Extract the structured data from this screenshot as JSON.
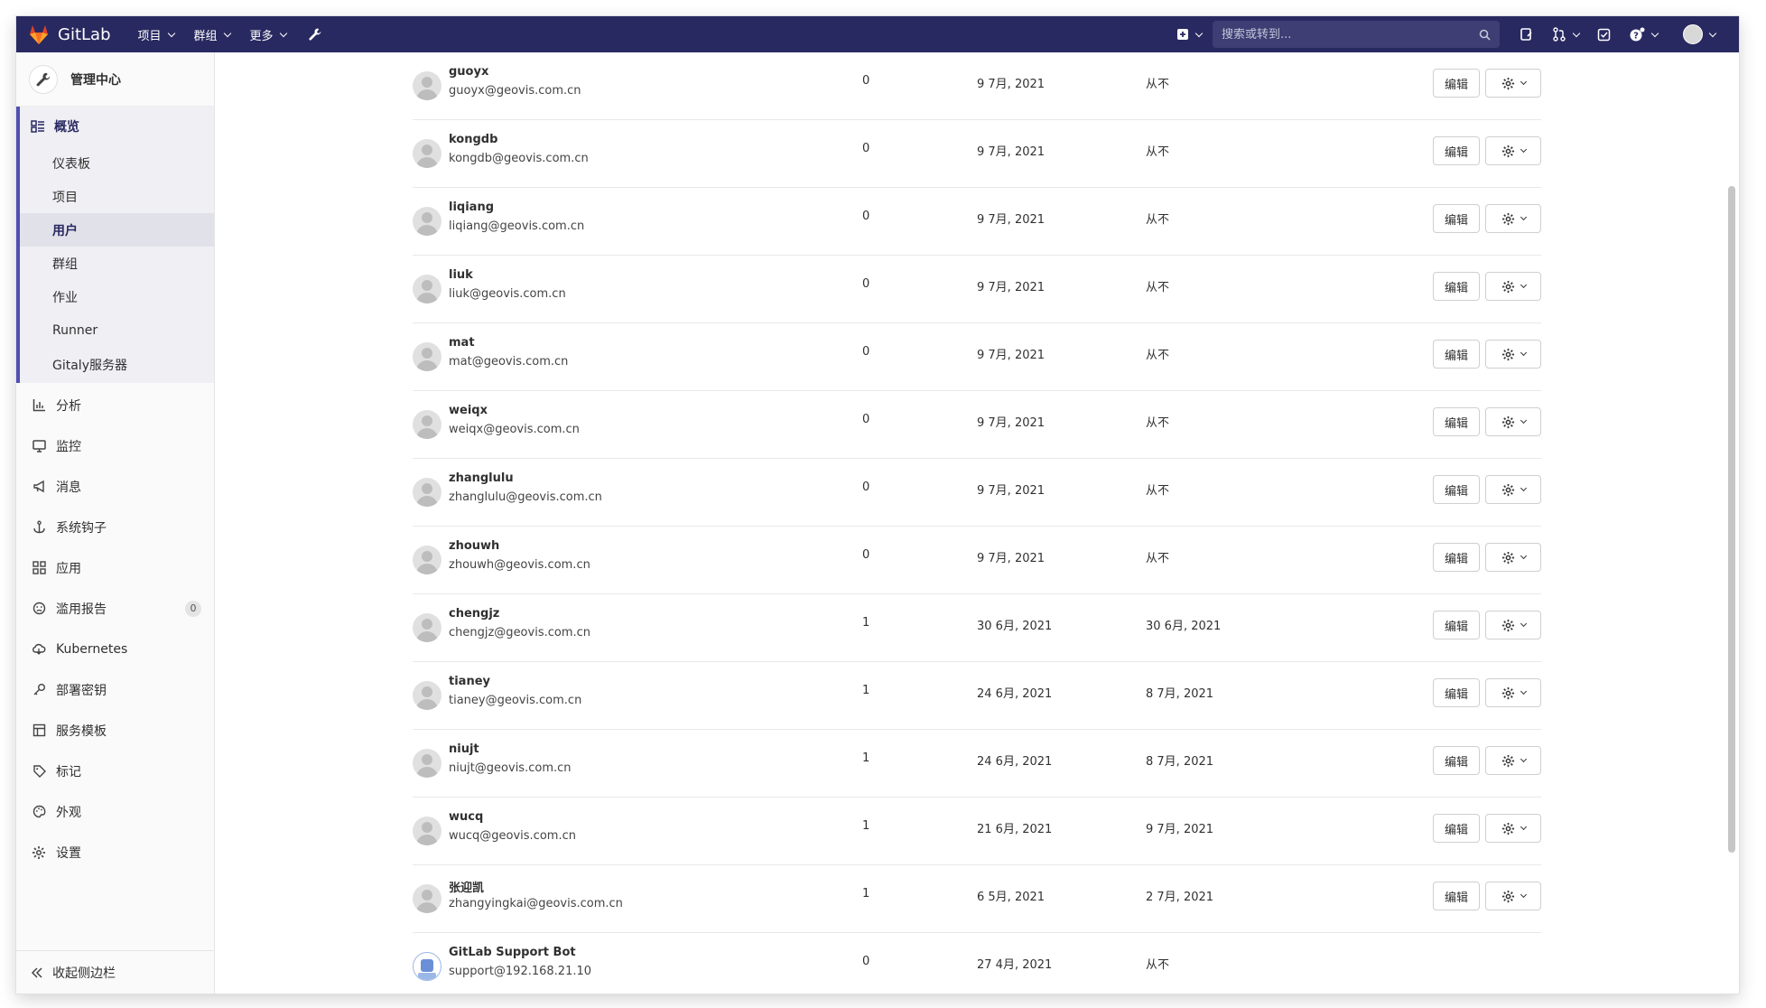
{
  "topbar": {
    "brand": "GitLab",
    "menu": [
      {
        "label": "项目"
      },
      {
        "label": "群组"
      },
      {
        "label": "更多"
      }
    ],
    "search_placeholder": "搜索或转到..."
  },
  "sidebar": {
    "title": "管理中心",
    "overview": {
      "label": "概览",
      "items": [
        {
          "label": "仪表板"
        },
        {
          "label": "项目"
        },
        {
          "label": "用户"
        },
        {
          "label": "群组"
        },
        {
          "label": "作业"
        },
        {
          "label": "Runner"
        },
        {
          "label": "Gitaly服务器"
        }
      ]
    },
    "items": [
      {
        "label": "分析",
        "icon": "chart-icon"
      },
      {
        "label": "监控",
        "icon": "monitor-icon"
      },
      {
        "label": "消息",
        "icon": "megaphone-icon"
      },
      {
        "label": "系统钩子",
        "icon": "anchor-icon"
      },
      {
        "label": "应用",
        "icon": "apps-icon"
      },
      {
        "label": "滥用报告",
        "icon": "abuse-icon",
        "badge": "0"
      },
      {
        "label": "Kubernetes",
        "icon": "cloud-icon"
      },
      {
        "label": "部署密钥",
        "icon": "key-icon"
      },
      {
        "label": "服务模板",
        "icon": "template-icon"
      },
      {
        "label": "标记",
        "icon": "label-icon"
      },
      {
        "label": "外观",
        "icon": "palette-icon"
      },
      {
        "label": "设置",
        "icon": "gear-icon"
      }
    ],
    "collapse_label": "收起侧边栏"
  },
  "users": {
    "edit_label": "编辑",
    "rows": [
      {
        "name": "guoyx",
        "email": "guoyx@geovis.com.cn",
        "projects": "0",
        "created": "9 7月, 2021",
        "last_activity": "从不"
      },
      {
        "name": "kongdb",
        "email": "kongdb@geovis.com.cn",
        "projects": "0",
        "created": "9 7月, 2021",
        "last_activity": "从不"
      },
      {
        "name": "liqiang",
        "email": "liqiang@geovis.com.cn",
        "projects": "0",
        "created": "9 7月, 2021",
        "last_activity": "从不"
      },
      {
        "name": "liuk",
        "email": "liuk@geovis.com.cn",
        "projects": "0",
        "created": "9 7月, 2021",
        "last_activity": "从不"
      },
      {
        "name": "mat",
        "email": "mat@geovis.com.cn",
        "projects": "0",
        "created": "9 7月, 2021",
        "last_activity": "从不"
      },
      {
        "name": "weiqx",
        "email": "weiqx@geovis.com.cn",
        "projects": "0",
        "created": "9 7月, 2021",
        "last_activity": "从不"
      },
      {
        "name": "zhanglulu",
        "email": "zhanglulu@geovis.com.cn",
        "projects": "0",
        "created": "9 7月, 2021",
        "last_activity": "从不"
      },
      {
        "name": "zhouwh",
        "email": "zhouwh@geovis.com.cn",
        "projects": "0",
        "created": "9 7月, 2021",
        "last_activity": "从不"
      },
      {
        "name": "chengjz",
        "email": "chengjz@geovis.com.cn",
        "projects": "1",
        "created": "30 6月, 2021",
        "last_activity": "30 6月, 2021"
      },
      {
        "name": "tianey",
        "email": "tianey@geovis.com.cn",
        "projects": "1",
        "created": "24 6月, 2021",
        "last_activity": "8 7月, 2021"
      },
      {
        "name": "niujt",
        "email": "niujt@geovis.com.cn",
        "projects": "1",
        "created": "24 6月, 2021",
        "last_activity": "8 7月, 2021"
      },
      {
        "name": "wucq",
        "email": "wucq@geovis.com.cn",
        "projects": "1",
        "created": "21 6月, 2021",
        "last_activity": "9 7月, 2021"
      },
      {
        "name": "张迎凯",
        "email": "zhangyingkai@geovis.com.cn",
        "projects": "1",
        "created": "6 5月, 2021",
        "last_activity": "2 7月, 2021"
      },
      {
        "name": "GitLab Support Bot",
        "email": "support@192.168.21.10",
        "projects": "0",
        "created": "27 4月, 2021",
        "last_activity": "从不",
        "bot": true
      }
    ]
  },
  "colors": {
    "navbar": "#292961",
    "accent": "#4f4fb4"
  }
}
